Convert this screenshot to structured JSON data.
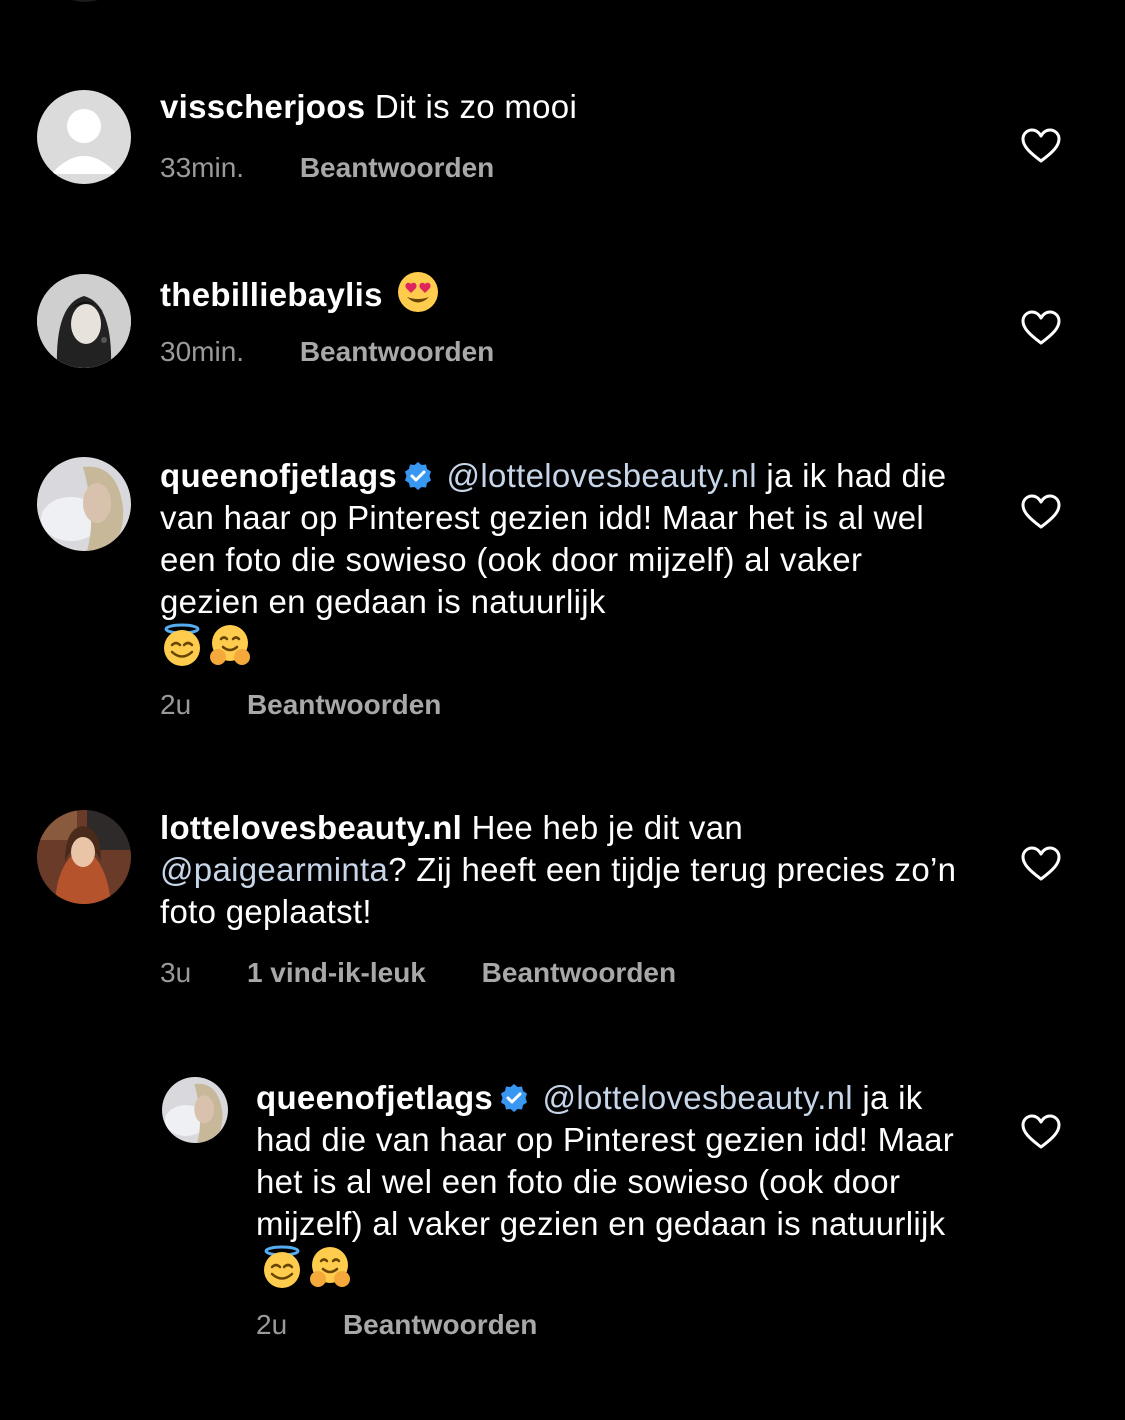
{
  "comments": [
    {
      "username": "visscherjoos",
      "text": "Dit is zo mooi",
      "time": "33min.",
      "reply_label": "Beantwoorden"
    },
    {
      "username": "thebilliebaylis",
      "text": "",
      "emoji": "heart-eyes-emoji",
      "time": "30min.",
      "reply_label": "Beantwoorden"
    },
    {
      "username": "queenofjetlags",
      "mention": "@lottelovesbeauty.nl",
      "text": "ja ik had die van haar op Pinterest gezien idd! Maar het is al wel een foto die sowieso (ook door mijzelf) al vaker gezien en gedaan is natuurlijk",
      "emojis": [
        "halo-emoji",
        "hug-emoji"
      ],
      "time": "2u",
      "reply_label": "Beantwoorden"
    },
    {
      "username": "lottelovesbeauty.nl",
      "text_before": "Hee heb je dit van",
      "mention": "@paigearminta",
      "text_after": "? Zij heeft een tijdje terug precies zo’n foto geplaatst!",
      "time": "3u",
      "likes": "1 vind-ik-leuk",
      "reply_label": "Beantwoorden"
    }
  ],
  "reply": {
    "username": "queenofjetlags",
    "mention": "@lottelovesbeauty.nl",
    "text": "ja ik had die van haar op Pinterest gezien idd! Maar het is al wel een foto die sowieso (ook door mijzelf) al vaker gezien en gedaan is natuurlijk",
    "emojis": [
      "halo-emoji",
      "hug-emoji"
    ],
    "time": "2u",
    "reply_label": "Beantwoorden"
  },
  "colors": {
    "background": "#000000",
    "text": "#ffffff",
    "meta": "#9a9a9a",
    "verified": "#3897f0"
  }
}
